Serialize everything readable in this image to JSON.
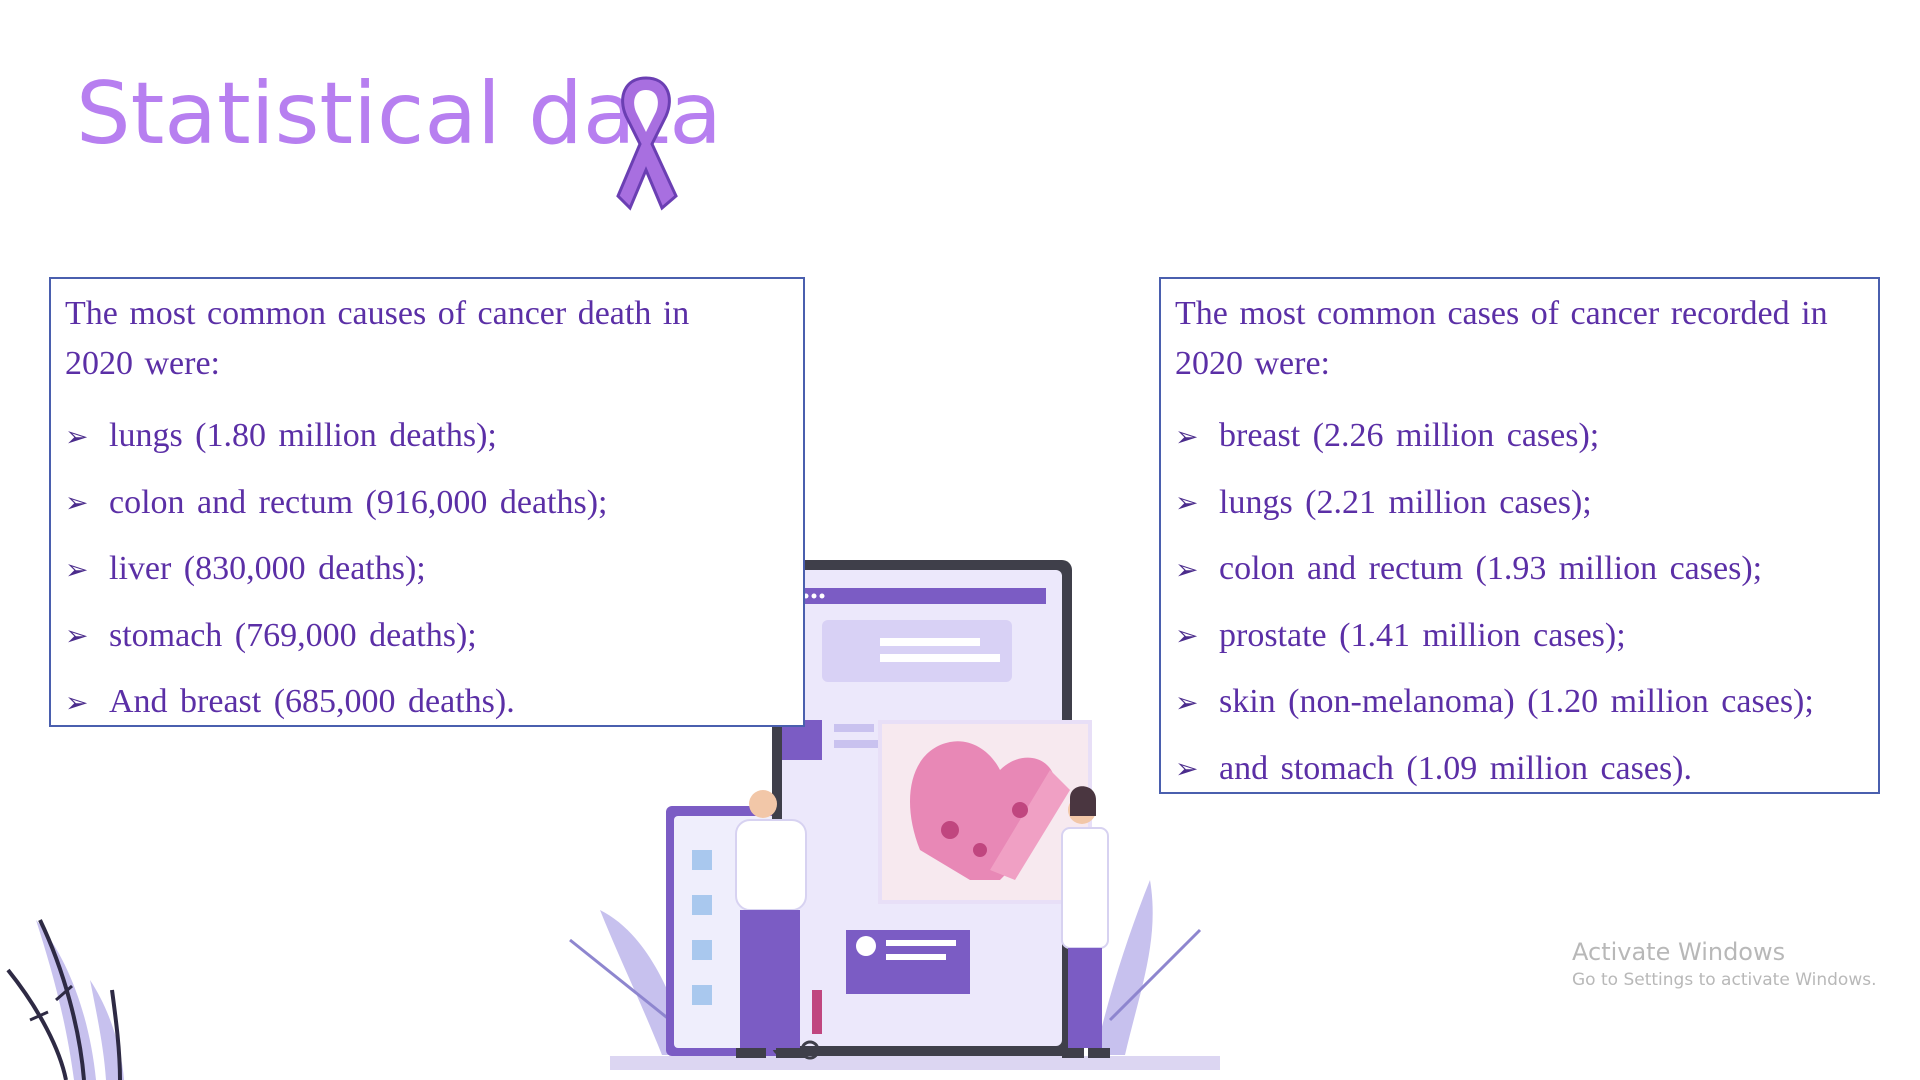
{
  "title": "Statistical data",
  "left_box": {
    "intro_line1": "The most common causes of cancer death in",
    "intro_line2": "2020 were:",
    "items": [
      "lungs (1.80 million deaths);",
      "colon and rectum (916,000 deaths);",
      "liver (830,000 deaths);",
      "stomach (769,000 deaths);",
      "And breast (685,000 deaths)."
    ]
  },
  "right_box": {
    "intro_line1": "The most common cases of cancer recorded in",
    "intro_line2": "2020 were:",
    "items": [
      "breast (2.26 million cases);",
      "lungs (2.21 million cases);",
      "colon and rectum (1.93 million cases);",
      "prostate (1.41 million cases);",
      "skin (non-melanoma) (1.20 million cases);",
      "and stomach (1.09 million cases)."
    ]
  },
  "bullet_glyph": "➢",
  "watermark": {
    "title": "Activate Windows",
    "subtitle": "Go to Settings to activate Windows."
  },
  "colors": {
    "title": "#b77ff0",
    "box_border": "#4a5fae",
    "box_text": "#5b2fa6",
    "accent_purple": "#7b5cc4",
    "ribbon": "#a86fe0"
  },
  "icons": {
    "ribbon": "awareness-ribbon-icon",
    "bullet": "arrowhead-bullet-icon",
    "illustration": "doctors-tablet-heart-illustration",
    "plant": "decorative-plant-icon"
  }
}
